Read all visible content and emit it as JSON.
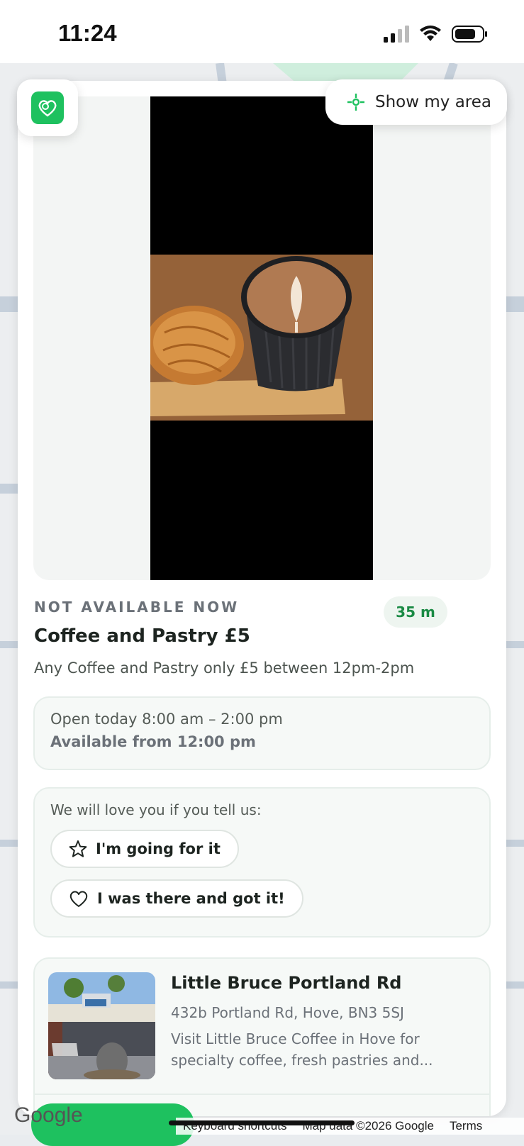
{
  "status_bar": {
    "time": "11:24"
  },
  "controls": {
    "area_button_label": "Show my area"
  },
  "offer": {
    "availability": "NOT AVAILABLE NOW",
    "distance": "35 m",
    "title": "Coffee and Pastry £5",
    "description": "Any Coffee and Pastry only £5 between 12pm-2pm",
    "hours": "Open today 8:00 am – 2:00 pm",
    "available_from": "Available from 12:00 pm"
  },
  "feedback": {
    "prompt": "We will love you if you tell us:",
    "going_label": "I'm going for it",
    "got_it_label": "I was there and got it!"
  },
  "venue": {
    "name": "Little Bruce Portland Rd",
    "address": "432b Portland Rd, Hove, BN3 5SJ",
    "description": "Visit Little Bruce Coffee in Hove for specialty coffee, fresh pastries and..."
  },
  "map": {
    "logo": "Google",
    "keyboard_shortcuts": "Keyboard shortcuts",
    "map_data": "Map data ©2026 Google",
    "terms": "Terms"
  },
  "colors": {
    "brand_green": "#1ec15f",
    "distance_text": "#1a8a44"
  }
}
